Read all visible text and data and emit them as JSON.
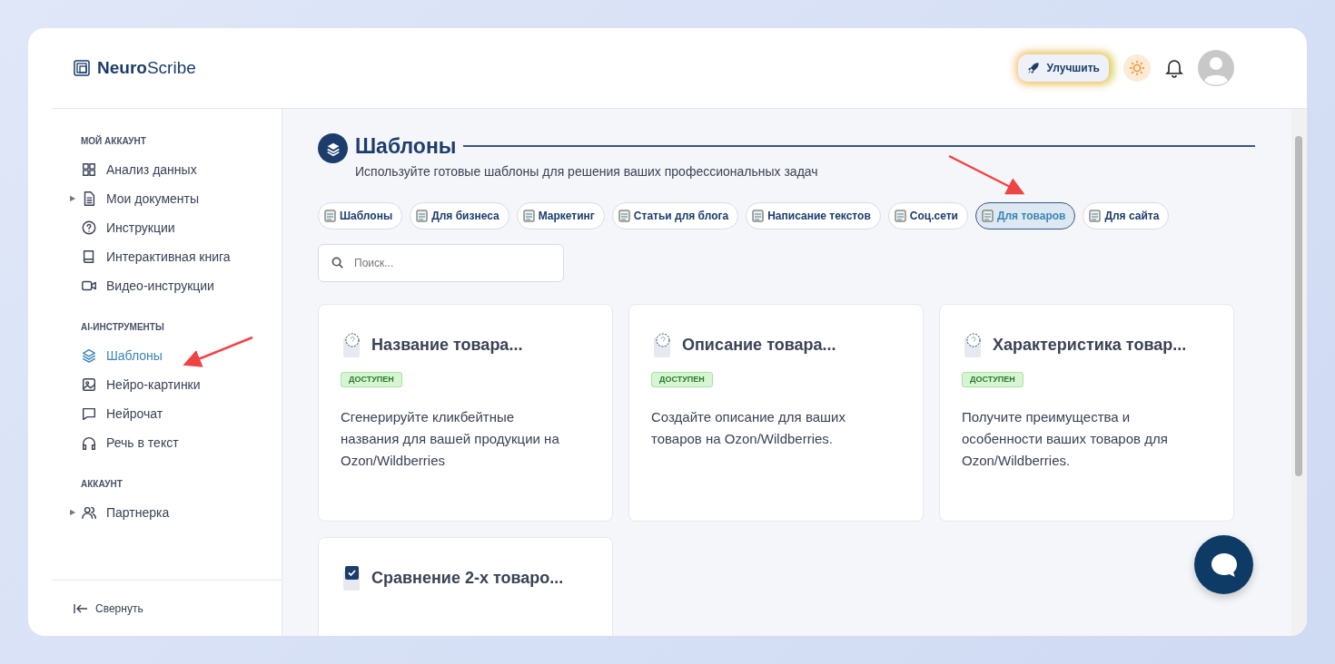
{
  "logo": {
    "bold": "Neuro",
    "light": "Scribe"
  },
  "header": {
    "upgrade_button": "Улучшить"
  },
  "sidebar": {
    "sections": [
      {
        "heading": "МОЙ АККАУНТ",
        "items": [
          {
            "label": "Анализ данных",
            "selected": false
          },
          {
            "label": "Мои документы",
            "caret": "▶",
            "selected": false
          },
          {
            "label": "Инструкции",
            "selected": false
          },
          {
            "label": "Интерактивная книга",
            "selected": false
          },
          {
            "label": "Видео-инструкции",
            "selected": false
          }
        ]
      },
      {
        "heading": "AI-ИНСТРУМЕНТЫ",
        "items": [
          {
            "label": "Шаблоны",
            "selected": true
          },
          {
            "label": "Нейро-картинки",
            "selected": false
          },
          {
            "label": "Нейрочат",
            "selected": false
          },
          {
            "label": "Речь в текст",
            "selected": false
          }
        ]
      },
      {
        "heading": "АККАУНТ",
        "items": [
          {
            "label": "Партнерка",
            "caret": "▶",
            "selected": false
          }
        ]
      }
    ],
    "collapse": "Свернуть"
  },
  "page": {
    "title": "Шаблоны",
    "subtitle": "Используйте готовые шаблоны для решения ваших профессиональных задач",
    "chips": [
      {
        "label": "Шаблоны",
        "selected": false
      },
      {
        "label": "Для бизнеса",
        "selected": false
      },
      {
        "label": "Маркетинг",
        "selected": false
      },
      {
        "label": "Статьи для блога",
        "selected": false
      },
      {
        "label": "Написание текстов",
        "selected": false
      },
      {
        "label": "Соц.сети",
        "selected": false
      },
      {
        "label": "Для товаров",
        "selected": true
      },
      {
        "label": "Для сайта",
        "selected": false
      }
    ],
    "search": {
      "placeholder": "Поиск..."
    },
    "cards": [
      {
        "title": "Название товара...",
        "kind": "draft",
        "badge": "ДОСТУПЕН",
        "description": "Сгенерируйте кликбейтные названия для вашей продукции на Ozon/Wildberries"
      },
      {
        "title": "Описание товара...",
        "kind": "draft",
        "badge": "ДОСТУПЕН",
        "description": "Создайте описание для ваших товаров на Ozon/Wildberries."
      },
      {
        "title": "Характеристика товар...",
        "kind": "draft",
        "badge": "ДОСТУПЕН",
        "description": "Получите преимущества и особенности ваших товаров для Ozon/Wildberries."
      },
      {
        "title": "Сравнение 2-х товаро...",
        "kind": "compare"
      }
    ]
  }
}
